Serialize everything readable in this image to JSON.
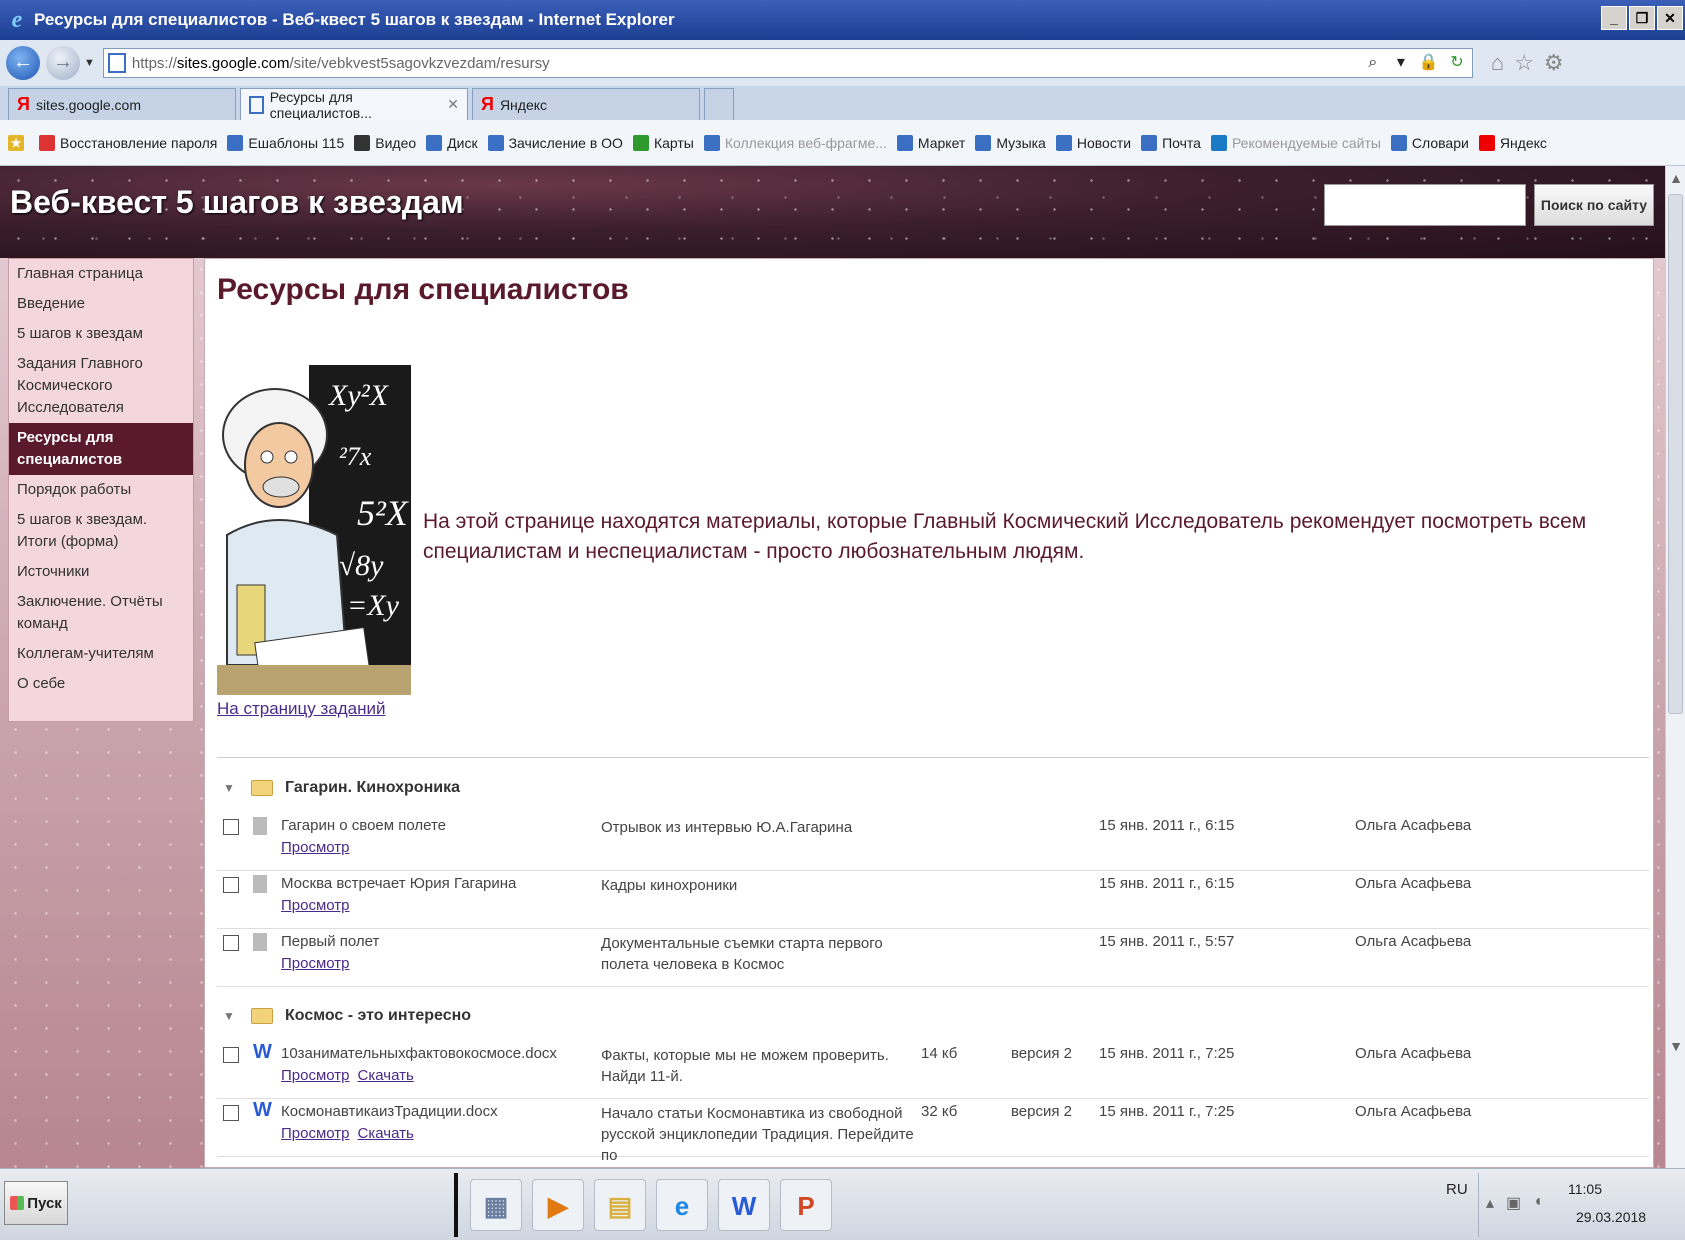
{
  "window": {
    "title": "Ресурсы для специалистов - Веб-квест 5 шагов к звездам - Internet Explorer"
  },
  "address": {
    "url_prefix": "https://",
    "url_host": "sites.google.com",
    "url_path": "/site/vebkvest5sagovkzvezdam/resursy"
  },
  "tabs": [
    {
      "label": "sites.google.com",
      "icon": "yandex-icon"
    },
    {
      "label": "Ресурсы для специалистов...",
      "icon": "page-icon",
      "active": true
    },
    {
      "label": "Яндекс",
      "icon": "yandex-icon"
    }
  ],
  "favorites": [
    {
      "label": "Восстановление пароля",
      "icon": "ru-flag-icon",
      "color": "#d33"
    },
    {
      "label": "Ешаблоны 115",
      "icon": "page-icon",
      "color": "#3b6fc4"
    },
    {
      "label": "Видео",
      "icon": "play-icon",
      "color": "#333"
    },
    {
      "label": "Диск",
      "icon": "disk-icon",
      "color": "#3b6fc4"
    },
    {
      "label": "Зачисление в ОО",
      "icon": "page-icon",
      "color": "#3b6fc4"
    },
    {
      "label": "Карты",
      "icon": "map-icon",
      "color": "#2e9a2e"
    },
    {
      "label": "Коллекция веб-фрагме...",
      "icon": "page-icon",
      "color": "#3b6fc4",
      "dim": true
    },
    {
      "label": "Маркет",
      "icon": "market-icon",
      "color": "#3b6fc4"
    },
    {
      "label": "Музыка",
      "icon": "music-icon",
      "color": "#3b6fc4"
    },
    {
      "label": "Новости",
      "icon": "news-icon",
      "color": "#3b6fc4"
    },
    {
      "label": "Почта",
      "icon": "mail-icon",
      "color": "#3b6fc4"
    },
    {
      "label": "Рекомендуемые сайты",
      "icon": "bing-icon",
      "color": "#1a7bc4",
      "dim": true
    },
    {
      "label": "Словари",
      "icon": "dict-icon",
      "color": "#3b6fc4"
    },
    {
      "label": "Яндекс",
      "icon": "yandex-icon",
      "color": "#e00"
    }
  ],
  "site": {
    "title": "Веб-квест 5 шагов к звездам",
    "search_button": "Поиск по сайту"
  },
  "sidebar": {
    "items": [
      {
        "label": "Главная страница"
      },
      {
        "label": "Введение"
      },
      {
        "label": "5 шагов к звездам"
      },
      {
        "label": "Задания Главного Космического Исследователя"
      },
      {
        "label": "Ресурсы для специалистов",
        "current": true
      },
      {
        "label": "Порядок работы"
      },
      {
        "label": "5 шагов к звездам. Итоги (форма)"
      },
      {
        "label": "Источники"
      },
      {
        "label": "Заключение. Отчёты команд"
      },
      {
        "label": "Коллегам-учителям"
      },
      {
        "label": "О себе"
      }
    ]
  },
  "content": {
    "page_title": "Ресурсы для специалистов",
    "intro": "На этой странице находятся материалы, которые Главный Космический Исследователь рекомендует посмотреть всем специалистам и неспециалистам - просто любознательным людям.",
    "tasks_link": "На страницу заданий"
  },
  "folders": [
    {
      "name": "Гагарин. Кинохроника",
      "files": [
        {
          "name": "Гагарин о своем полете",
          "links": [
            "Просмотр"
          ],
          "desc": "Отрывок из интервью Ю.А.Гагарина",
          "size": "",
          "version": "",
          "date": "15 янв. 2011 г., 6:15",
          "author": "Ольга Асафьева",
          "icon": "file-icon"
        },
        {
          "name": "Москва встречает Юрия Гагарина",
          "links": [
            "Просмотр"
          ],
          "desc": "Кадры кинохроники",
          "size": "",
          "version": "",
          "date": "15 янв. 2011 г., 6:15",
          "author": "Ольга Асафьева",
          "icon": "file-icon"
        },
        {
          "name": "Первый полет",
          "links": [
            "Просмотр"
          ],
          "desc": "Документальные съемки старта первого полета человека в Космос",
          "size": "",
          "version": "",
          "date": "15 янв. 2011 г., 5:57",
          "author": "Ольга Асафьева",
          "icon": "file-icon"
        }
      ]
    },
    {
      "name": "Космос - это интересно",
      "files": [
        {
          "name": "10занимательныхфактовокосмосе.docx",
          "links": [
            "Просмотр",
            "Скачать"
          ],
          "desc": "Факты, которые мы не можем проверить. Найди 11-й.",
          "size": "14 кб",
          "version": "версия 2",
          "date": "15 янв. 2011 г., 7:25",
          "author": "Ольга Асафьева",
          "icon": "word-icon"
        },
        {
          "name": "КосмонавтикаизТрадиции.docx",
          "links": [
            "Просмотр",
            "Скачать"
          ],
          "desc": "Начало статьи Космонавтика из свободной русской энциклопедии Традиция. Перейдите по",
          "size": "32 кб",
          "version": "версия 2",
          "date": "15 янв. 2011 г., 7:25",
          "author": "Ольга Асафьева",
          "icon": "word-icon"
        }
      ]
    }
  ],
  "taskbar": {
    "start_label": "Пуск",
    "lang": "RU",
    "time": "11:05",
    "date": "29.03.2018",
    "apps": [
      {
        "icon": "calculator-icon",
        "glyph": "▦",
        "color": "#6b7fa0"
      },
      {
        "icon": "media-player-icon",
        "glyph": "▶",
        "color": "#e07a10"
      },
      {
        "icon": "explorer-folder-icon",
        "glyph": "▤",
        "color": "#d9b040"
      },
      {
        "icon": "internet-explorer-icon",
        "glyph": "e",
        "color": "#1e88e5"
      },
      {
        "icon": "word-icon",
        "glyph": "W",
        "color": "#2a5bd7"
      },
      {
        "icon": "powerpoint-icon",
        "glyph": "P",
        "color": "#d24726"
      }
    ]
  }
}
